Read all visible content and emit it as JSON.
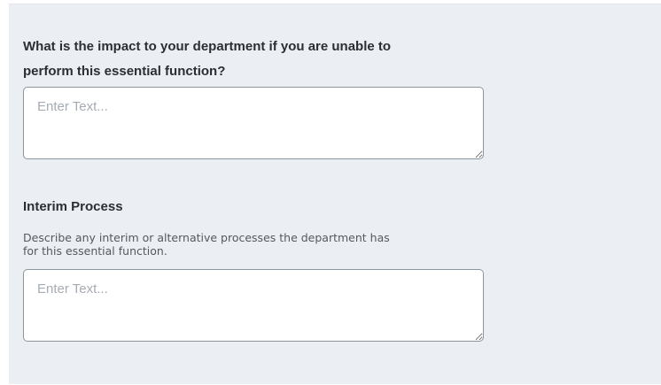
{
  "impact_question": {
    "label": "What is the impact to your department if you are unable to perform this essential function?",
    "placeholder": "Enter Text...",
    "value": ""
  },
  "interim_process": {
    "heading": "Interim Process",
    "description": "Describe any interim or alternative processes the department has for this essential function.",
    "placeholder": "Enter Text...",
    "value": ""
  }
}
